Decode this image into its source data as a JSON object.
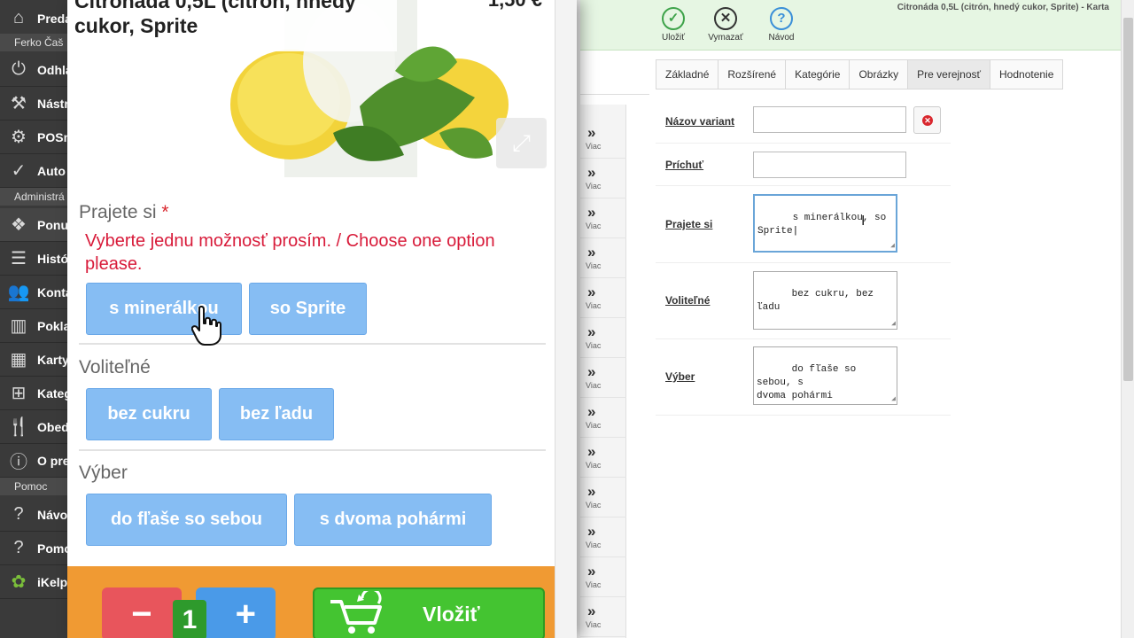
{
  "sidebar": {
    "items_top": [
      {
        "icon": "home-icon",
        "glyph": "⌂",
        "label": "Preda"
      }
    ],
    "user_label": "Ferko Čaš",
    "items_user": [
      {
        "icon": "power-icon",
        "glyph": "⏻",
        "label": "Odhlá"
      },
      {
        "icon": "tools-icon",
        "glyph": "⚒",
        "label": "Nástr"
      },
      {
        "icon": "gear-icon",
        "glyph": "⚙",
        "label": "POSm"
      },
      {
        "icon": "check-circle-icon",
        "glyph": "✓",
        "label": "Auto"
      }
    ],
    "admin_label": "Administrá",
    "items_admin": [
      {
        "icon": "offer-icon",
        "glyph": "❖",
        "label": "Ponu"
      },
      {
        "icon": "list-icon",
        "glyph": "☰",
        "label": "Histó"
      },
      {
        "icon": "users-icon",
        "glyph": "👥",
        "label": "Konta"
      },
      {
        "icon": "bar-chart-icon",
        "glyph": "▥",
        "label": "Pokla"
      },
      {
        "icon": "cards-icon",
        "glyph": "▦",
        "label": "Karty"
      },
      {
        "icon": "category-tree-icon",
        "glyph": "⊞",
        "label": "Kateg"
      },
      {
        "icon": "cutlery-icon",
        "glyph": "🍴",
        "label": "Obed"
      },
      {
        "icon": "info-icon",
        "glyph": "ⓘ",
        "label": "O pre"
      }
    ],
    "help_label": "Pomoc",
    "items_help": [
      {
        "icon": "help-icon",
        "glyph": "?",
        "label": "Návo"
      },
      {
        "icon": "help-circle-icon",
        "glyph": "?",
        "label": "Pomo"
      },
      {
        "icon": "ikelp-logo-icon",
        "glyph": "✿",
        "label": "iKelp"
      }
    ]
  },
  "popup": {
    "product_title": "Citronáda 0,5L (citrón, hnedý cukor, Sprite",
    "price": "1,50 €",
    "groups": {
      "prajete": {
        "title": "Prajete si",
        "required_mark": "*",
        "error": "Vyberte jednu možnosť prosím. / Choose one option please.",
        "options": [
          "s minerálkou",
          "so Sprite"
        ]
      },
      "volitelne": {
        "title": "Voliteľné",
        "options": [
          "bez cukru",
          "bez ľadu"
        ]
      },
      "vyber": {
        "title": "Výber",
        "options": [
          "do fľaše so sebou",
          "s dvoma pohármi"
        ]
      }
    },
    "quantity": "1",
    "minus_label": "−",
    "plus_label": "+",
    "insert_label": "Vložiť"
  },
  "toolbar": {
    "save_label": "Uložiť",
    "delete_label": "Vymazať",
    "help_label": "Návod",
    "window_title": "Citronáda 0,5L (citrón, hnedý cukor, Sprite) - Karta"
  },
  "list": {
    "more_label": "Viac",
    "chevron": "»"
  },
  "tabs": [
    "Základné",
    "Rozšírené",
    "Kategórie",
    "Obrázky",
    "Pre verejnosť",
    "Hodnotenie"
  ],
  "active_tab": "Pre verejnosť",
  "form": {
    "variant_name_label": "Názov variant",
    "variant_name_value": "",
    "flavor_label": "Príchuť",
    "flavor_value": "",
    "prajete_label": "Prajete si",
    "prajete_value": "s minerálkou, so\nSprite",
    "volitelne_label": "Voliteľné",
    "volitelne_value": "bez cukru, bez ľadu",
    "vyber_label": "Výber",
    "vyber_value": "do fľaše so sebou, s\ndvoma pohármi"
  },
  "colors": {
    "sidebar_bg": "#3a3a3a",
    "toolbar_bg": "#e6f6e3",
    "option_button": "#86bdf3",
    "error_text": "#d81b3a",
    "bottom_bar": "#f09a33",
    "insert_button": "#44c431",
    "minus_button": "#e8555c",
    "plus_button": "#4a9ae8"
  }
}
